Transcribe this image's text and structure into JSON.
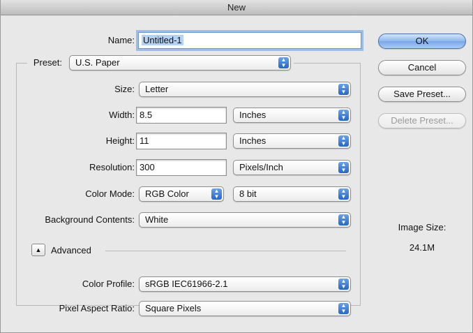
{
  "window": {
    "title": "New"
  },
  "name": {
    "label": "Name:",
    "value": "Untitled-1"
  },
  "preset": {
    "label": "Preset:",
    "value": "U.S. Paper"
  },
  "size": {
    "label": "Size:",
    "value": "Letter"
  },
  "width": {
    "label": "Width:",
    "value": "8.5",
    "unit": "Inches"
  },
  "height": {
    "label": "Height:",
    "value": "11",
    "unit": "Inches"
  },
  "resolution": {
    "label": "Resolution:",
    "value": "300",
    "unit": "Pixels/Inch"
  },
  "color_mode": {
    "label": "Color Mode:",
    "value": "RGB Color",
    "depth": "8 bit"
  },
  "background": {
    "label": "Background Contents:",
    "value": "White"
  },
  "advanced": {
    "label": "Advanced"
  },
  "color_profile": {
    "label": "Color Profile:",
    "value": "sRGB IEC61966-2.1"
  },
  "pixel_aspect": {
    "label": "Pixel Aspect Ratio:",
    "value": "Square Pixels"
  },
  "buttons": {
    "ok": "OK",
    "cancel": "Cancel",
    "save_preset": "Save Preset...",
    "delete_preset": "Delete Preset..."
  },
  "image_size": {
    "label": "Image Size:",
    "value": "24.1M"
  },
  "icons": {
    "popup": "up-down-arrows-icon",
    "disclosure": "triangle-up-icon"
  }
}
